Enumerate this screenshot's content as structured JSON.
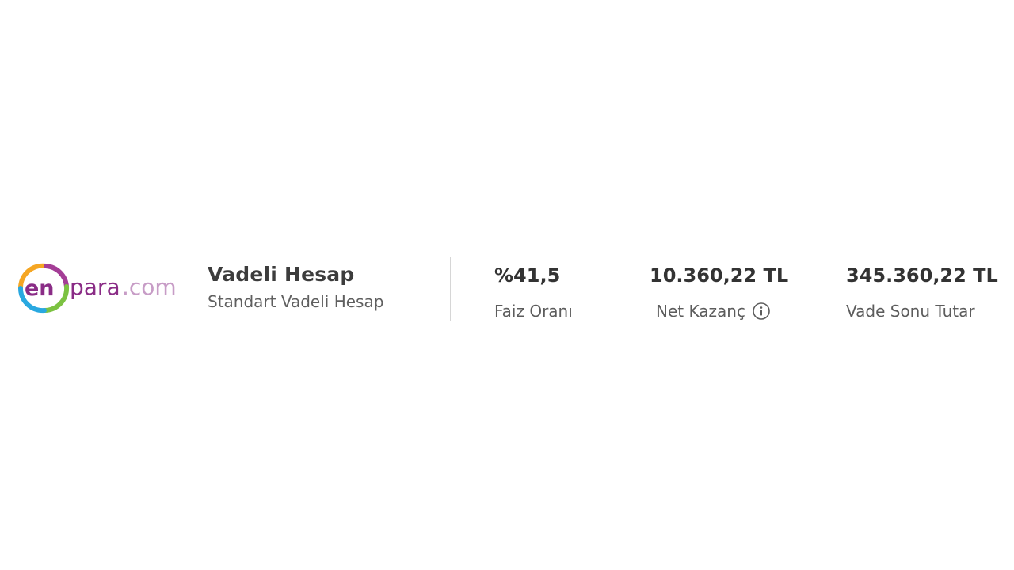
{
  "brand": {
    "logo_text_en": "en",
    "logo_text_para": "para",
    "logo_text_com": ".com",
    "colors": {
      "purple": "#8a2c86",
      "ring_orange": "#f5a623",
      "ring_green": "#7cc242",
      "ring_blue": "#29a8e0",
      "ring_purple": "#a43d96"
    }
  },
  "product": {
    "title": "Vadeli Hesap",
    "subtitle": "Standart Vadeli Hesap"
  },
  "stats": {
    "rate": {
      "value": "%41,5",
      "label": "Faiz Oranı"
    },
    "net_gain": {
      "value": "10.360,22 TL",
      "label": "Net Kazanç",
      "icon": "info-icon"
    },
    "maturity_total": {
      "value": "345.360,22 TL",
      "label": "Vade Sonu Tutar"
    }
  }
}
